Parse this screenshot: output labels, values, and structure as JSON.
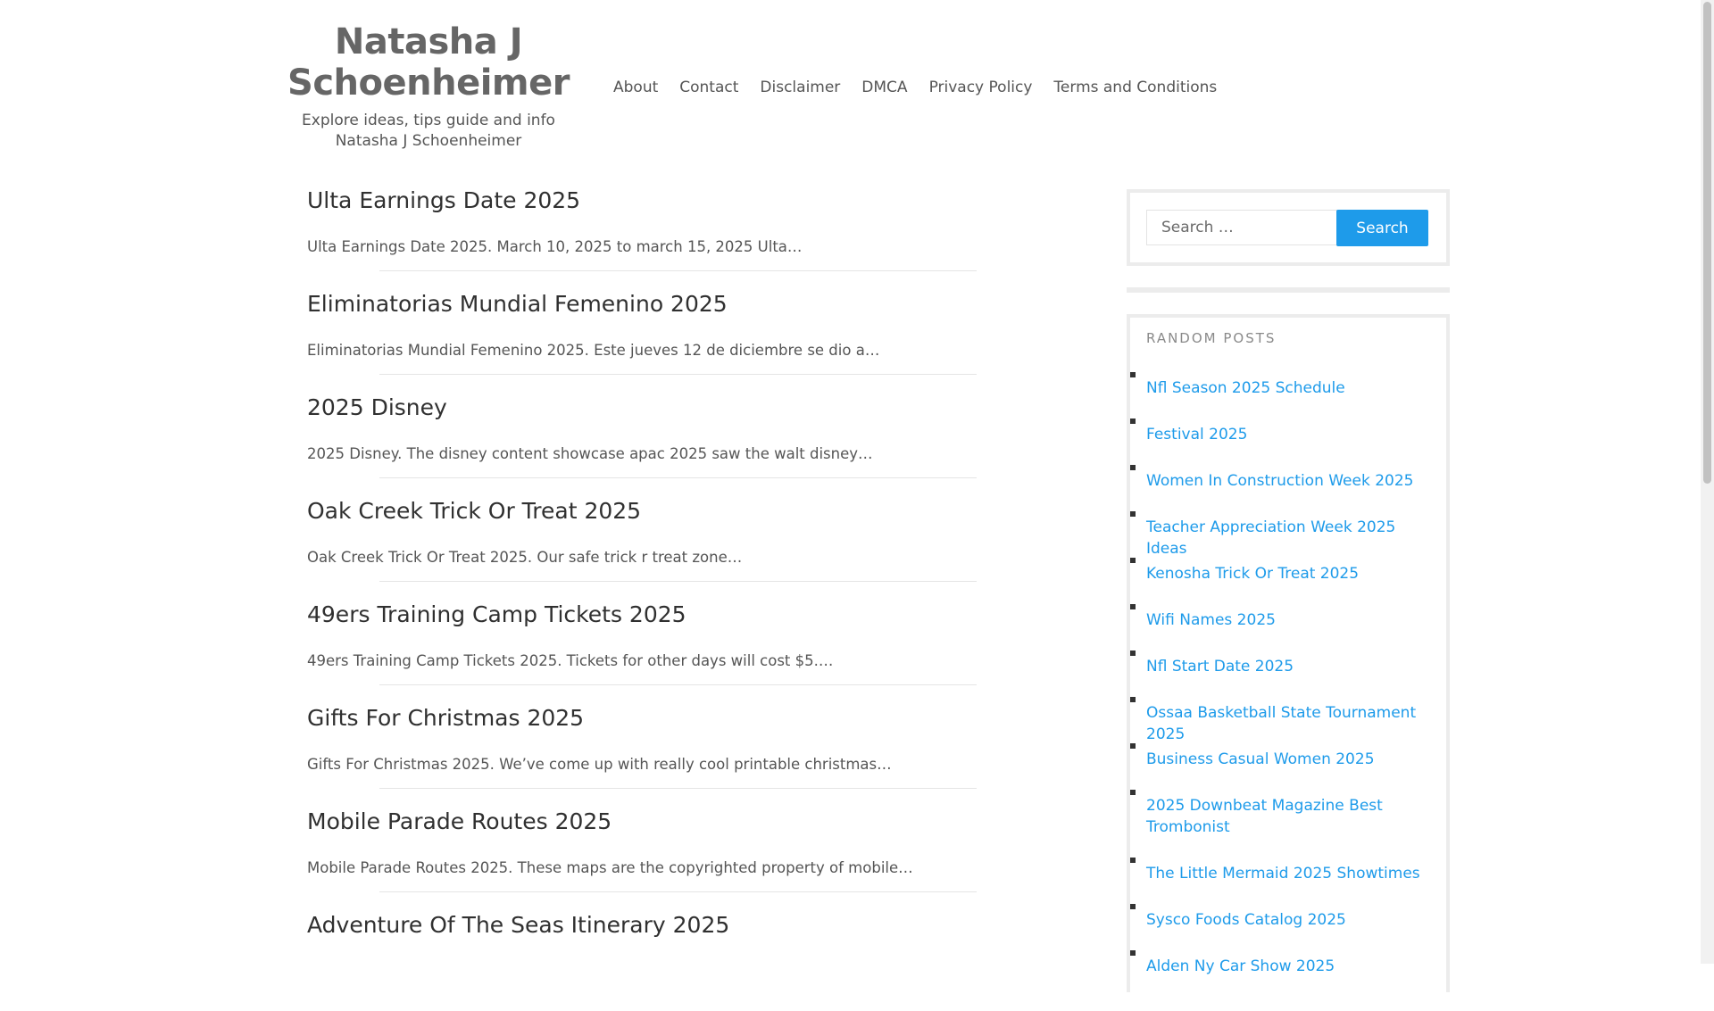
{
  "site": {
    "title": "Natasha J Schoenheimer",
    "description": "Explore ideas, tips guide and info Natasha J Schoenheimer"
  },
  "nav": [
    "About",
    "Contact",
    "Disclaimer",
    "DMCA",
    "Privacy Policy",
    "Terms and Conditions"
  ],
  "posts": [
    {
      "title": "Ulta Earnings Date 2025",
      "excerpt": "Ulta Earnings Date 2025. March 10, 2025 to march 15, 2025 Ulta…"
    },
    {
      "title": "Eliminatorias Mundial Femenino 2025",
      "excerpt": "Eliminatorias Mundial Femenino 2025. Este jueves 12 de diciembre se dio a…"
    },
    {
      "title": "2025 Disney",
      "excerpt": "2025 Disney. The disney content showcase apac 2025 saw the walt disney…"
    },
    {
      "title": "Oak Creek Trick Or Treat 2025",
      "excerpt": "Oak Creek Trick Or Treat 2025. Our safe trick r treat zone…"
    },
    {
      "title": "49ers Training Camp Tickets 2025",
      "excerpt": "49ers Training Camp Tickets 2025. Tickets for other days will cost $5.…"
    },
    {
      "title": "Gifts For Christmas 2025",
      "excerpt": "Gifts For Christmas 2025. We’ve come up with really cool printable christmas…"
    },
    {
      "title": "Mobile Parade Routes 2025",
      "excerpt": "Mobile Parade Routes 2025. These maps are the copyrighted property of mobile…"
    },
    {
      "title": "Adventure Of The Seas Itinerary 2025",
      "excerpt": ""
    }
  ],
  "search": {
    "placeholder": "Search …",
    "button_label": "Search"
  },
  "random_posts": {
    "heading": "RANDOM POSTS",
    "items": [
      "Nfl Season 2025 Schedule",
      "Festival 2025",
      "Women In Construction Week 2025",
      "Teacher Appreciation Week 2025 Ideas",
      "Kenosha Trick Or Treat 2025",
      "Wifi Names 2025",
      "Nfl Start Date 2025",
      "Ossaa Basketball State Tournament 2025",
      "Business Casual Women 2025",
      "2025 Downbeat Magazine Best Trombonist",
      "The Little Mermaid 2025 Showtimes",
      "Sysco Foods Catalog 2025",
      "Alden Ny Car Show 2025"
    ]
  },
  "colors": {
    "link": "#1e9bea",
    "button": "#1e9bea",
    "title": "#666666"
  }
}
